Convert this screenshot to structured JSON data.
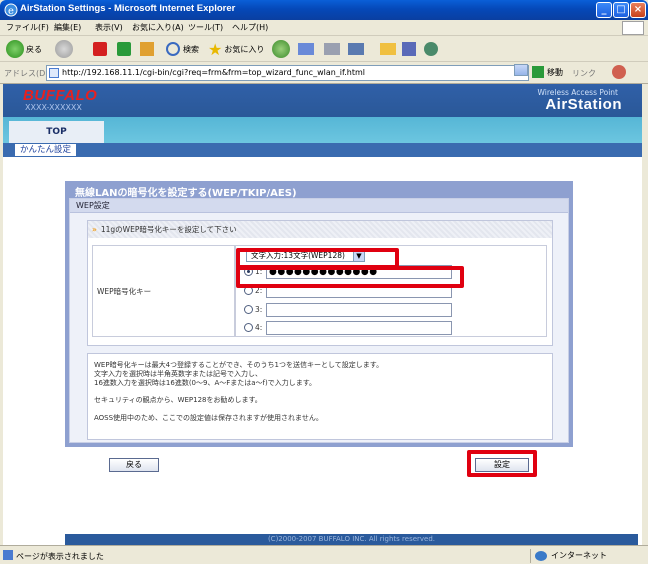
{
  "window": {
    "title": "AirStation Settings - Microsoft Internet Explorer"
  },
  "menu": [
    "ファイル(F)",
    "編集(E)",
    "表示(V)",
    "お気に入り(A)",
    "ツール(T)",
    "ヘルプ(H)"
  ],
  "toolbar": {
    "back": "戻る",
    "search": "検索",
    "favorites": "お気に入り"
  },
  "address": {
    "label": "アドレス(D)",
    "url": "http://192.168.11.1/cgi-bin/cgi?req=frm&frm=top_wizard_func_wlan_if.html",
    "go": "移動",
    "links": "リンク"
  },
  "header": {
    "brand": "BUFFALO",
    "model": "XXXX-XXXXXX",
    "tagline": "Wireless Access Point",
    "product": "AirStation"
  },
  "nav": {
    "tab_top": "TOP",
    "sub_easy": "かんたん設定"
  },
  "panel": {
    "title": "無線LANの暗号化を設定する(WEP/TKIP/AES)",
    "section": "WEP設定",
    "hint": "11gのWEP暗号化キーを設定して下さい",
    "row_label": "WEP暗号化キー",
    "select_value": "文字入力:13文字(WEP128)",
    "keys": [
      {
        "num": "1:",
        "value": "●●●●●●●●●●●●●"
      },
      {
        "num": "2:",
        "value": ""
      },
      {
        "num": "3:",
        "value": ""
      },
      {
        "num": "4:",
        "value": ""
      }
    ],
    "notes": [
      "WEP暗号化キーは最大4つ登録することができ、そのうち1つを送信キーとして設定します。",
      "文字入力を選択時は半角英数字または記号で入力し、",
      "16進数入力を選択時は16進数(0〜9、A〜Fまたはa〜f)で入力します。",
      "セキュリティの観点から、WEP128をお勧めします。",
      "AOSS使用中のため、ここでの設定値は保存されますが使用されません。"
    ]
  },
  "buttons": {
    "back": "戻る",
    "submit": "設定"
  },
  "footer": "(C)2000-2007 BUFFALO INC. All rights reserved.",
  "status": {
    "text": "ページが表示されました",
    "zone": "インターネット"
  }
}
